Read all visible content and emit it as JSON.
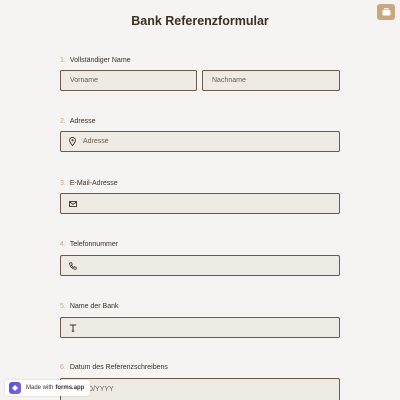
{
  "form": {
    "title": "Bank Referenzformular"
  },
  "questions": [
    {
      "number": "1.",
      "label": "Vollständiger Name",
      "first_placeholder": "Vorname",
      "last_placeholder": "Nachname"
    },
    {
      "number": "2.",
      "label": "Adresse",
      "placeholder": "Adresse",
      "icon": "location-pin-icon"
    },
    {
      "number": "3.",
      "label": "E-Mail-Adresse",
      "placeholder": "",
      "icon": "mail-icon"
    },
    {
      "number": "4.",
      "label": "Telefonnummer",
      "placeholder": "",
      "icon": "phone-icon"
    },
    {
      "number": "5.",
      "label": "Name der Bank",
      "placeholder": "",
      "icon": "text-icon"
    },
    {
      "number": "6.",
      "label": "Datum des Referenzschreibens",
      "placeholder": "DD/YYYY",
      "icon": "calendar-icon"
    }
  ],
  "badge": {
    "prefix": "Made with",
    "brand": "forms.app"
  },
  "colors": {
    "accent": "#c8a97f",
    "field_bg": "#eeebe5",
    "field_border": "#6b5a4a",
    "page_bg": "#f5f4f3",
    "text": "#3d2f23"
  }
}
